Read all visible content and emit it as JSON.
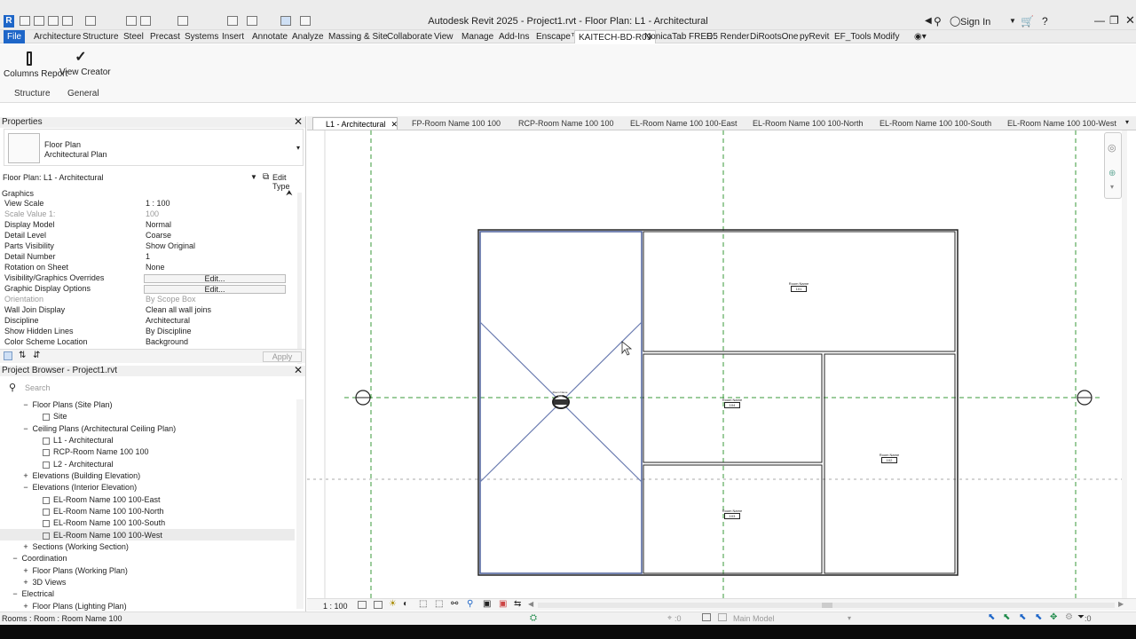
{
  "titlebar": {
    "title": "Autodesk Revit 2025 - Project1.rvt - Floor Plan: L1 - Architectural",
    "signin": "Sign In"
  },
  "ribbon_tabs": [
    "File",
    "Architecture",
    "Structure",
    "Steel",
    "Precast",
    "Systems",
    "Insert",
    "Annotate",
    "Analyze",
    "Massing & Site",
    "Collaborate",
    "View",
    "Manage",
    "Add-Ins",
    "Enscape™",
    "KAITECH-BD-R09",
    "NonicaTab FREE",
    "D5 Render",
    "DiRootsOne",
    "pyRevit",
    "EF_Tools",
    "Modify"
  ],
  "ribbon": {
    "btn1": "Columns Report",
    "btn2": "View Creator",
    "panel1": "Structure",
    "panel2": "General"
  },
  "properties": {
    "title": "Properties",
    "type_name": "Floor Plan",
    "type_sub": "Architectural Plan",
    "instance": "Floor Plan: L1 - Architectural",
    "edit_type": "Edit Type",
    "group": "Graphics",
    "rows": [
      {
        "k": "View Scale",
        "v": "1 : 100"
      },
      {
        "k": "Scale Value    1:",
        "v": "100"
      },
      {
        "k": "Display Model",
        "v": "Normal"
      },
      {
        "k": "Detail Level",
        "v": "Coarse"
      },
      {
        "k": "Parts Visibility",
        "v": "Show Original"
      },
      {
        "k": "Detail Number",
        "v": "1"
      },
      {
        "k": "Rotation on Sheet",
        "v": "None"
      },
      {
        "k": "Visibility/Graphics Overrides",
        "v": "Edit..."
      },
      {
        "k": "Graphic Display Options",
        "v": "Edit..."
      },
      {
        "k": "Orientation",
        "v": "By Scope Box"
      },
      {
        "k": "Wall Join Display",
        "v": "Clean all wall joins"
      },
      {
        "k": "Discipline",
        "v": "Architectural"
      },
      {
        "k": "Show Hidden Lines",
        "v": "By Discipline"
      },
      {
        "k": "Color Scheme Location",
        "v": "Background"
      }
    ],
    "apply": "Apply"
  },
  "browser": {
    "title": "Project Browser - Project1.rvt",
    "search": "Search",
    "items": [
      {
        "t": "Floor Plans (Site Plan)",
        "lvl": 2,
        "tog": "−"
      },
      {
        "t": "Site",
        "lvl": 3,
        "tog": ""
      },
      {
        "t": "Ceiling Plans (Architectural Ceiling Plan)",
        "lvl": 2,
        "tog": "−"
      },
      {
        "t": "L1 - Architectural",
        "lvl": 3,
        "tog": ""
      },
      {
        "t": "RCP-Room Name 100 100",
        "lvl": 3,
        "tog": ""
      },
      {
        "t": "L2 - Architectural",
        "lvl": 3,
        "tog": ""
      },
      {
        "t": "Elevations (Building Elevation)",
        "lvl": 2,
        "tog": "+"
      },
      {
        "t": "Elevations (Interior Elevation)",
        "lvl": 2,
        "tog": "−"
      },
      {
        "t": "EL-Room Name 100 100-East",
        "lvl": 3,
        "tog": ""
      },
      {
        "t": "EL-Room Name 100 100-North",
        "lvl": 3,
        "tog": ""
      },
      {
        "t": "EL-Room Name 100 100-South",
        "lvl": 3,
        "tog": ""
      },
      {
        "t": "EL-Room Name 100 100-West",
        "lvl": 3,
        "tog": ""
      },
      {
        "t": "Sections (Working Section)",
        "lvl": 2,
        "tog": "+"
      },
      {
        "t": "Coordination",
        "lvl": 1,
        "tog": "−"
      },
      {
        "t": "Floor Plans (Working Plan)",
        "lvl": 2,
        "tog": "+"
      },
      {
        "t": "3D Views",
        "lvl": 2,
        "tog": "+"
      },
      {
        "t": "Electrical",
        "lvl": 1,
        "tog": "−"
      },
      {
        "t": "Floor Plans (Lighting Plan)",
        "lvl": 2,
        "tog": "+"
      }
    ]
  },
  "view_tabs": [
    "L1 - Architectural",
    "FP-Room Name 100 100",
    "RCP-Room Name 100 100",
    "EL-Room Name 100 100-East",
    "EL-Room Name 100 100-North",
    "EL-Room Name 100 100-South",
    "EL-Room Name 100 100-West"
  ],
  "rooms": [
    {
      "name": "Room Name",
      "number": "101"
    },
    {
      "name": "Room Name",
      "number": "104"
    },
    {
      "name": "Room Name",
      "number": "102"
    },
    {
      "name": "Room Name",
      "number": "103"
    },
    {
      "name": "Room Name",
      "number": "100"
    }
  ],
  "viewctrl": {
    "scale": "1 : 100"
  },
  "status": {
    "text": "Rooms : Room : Room Name 100",
    "zero": ":0",
    "model": "Main Model"
  }
}
